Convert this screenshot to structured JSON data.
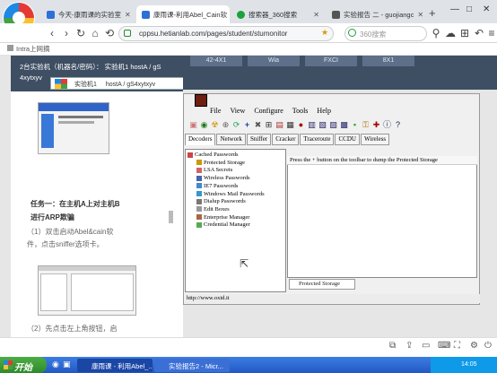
{
  "browser": {
    "tabs": [
      {
        "label": "今天-康雨课的实验室",
        "active": false,
        "color": "#2f6fd8"
      },
      {
        "label": "康雨课-利用Abel_Cain软",
        "active": true,
        "color": "#2f6fd8"
      },
      {
        "label": "搜索器_360搜索",
        "active": false,
        "color": "#19a33a"
      },
      {
        "label": "实验报告 二 - guojiangc",
        "active": false,
        "color": "#555555"
      }
    ],
    "new_tab": "+",
    "win_min": "—",
    "win_max": "□",
    "win_close": "✕",
    "address": "cppsu.hetianlab.com/pages/student/stumonitor",
    "search_placeholder": "360搜索",
    "bookmark": "Intra上网摘"
  },
  "left_panel": {
    "topinfo_line1": "2台实验机（机器名/密码）：  实验机1   hostA / gS",
    "topinfo_line2": "4xytxyv",
    "vm_select_label": "实验机1",
    "vm_select_value": "hostA / gS4xytxyv",
    "task1_title_1": "任务一：在主机A上对主机B",
    "task1_title_2": "进行ARP欺骗",
    "step1_line1": "（1）双击启动Abel&cain软",
    "step1_line2": "件，点击sniffer选项卡。",
    "step2": "（2）先点击左上角按钮，启"
  },
  "vm_tabs": [
    "42-4X1",
    "Wia",
    "FXCI",
    "8X1"
  ],
  "cain": {
    "menu": [
      "File",
      "View",
      "Configure",
      "Tools",
      "Help"
    ],
    "tabs": [
      "Decoders",
      "Network",
      "Sniffer",
      "Cracker",
      "Traceroute",
      "CCDU",
      "Wireless"
    ],
    "tree_root": "Cached Passwords",
    "tree_items": [
      "Protected Storage",
      "LSA Secrets",
      "Wireless Passwords",
      "IE7 Passwords",
      "Windows Mail Passwords",
      "Dialup Passwords",
      "Edit Boxes",
      "Enterprise Manager",
      "Credential Manager"
    ],
    "detail_text": "Press the + button on the toolbar to dump the Protected Storage",
    "bottom_tab": "Protected Storage",
    "status": "http://www.oxid.it"
  },
  "taskbar": {
    "start": "开始",
    "items": [
      "康雨课 - 利用Abel_...",
      "实验报告2 - Micr..."
    ],
    "time": "14:05"
  }
}
